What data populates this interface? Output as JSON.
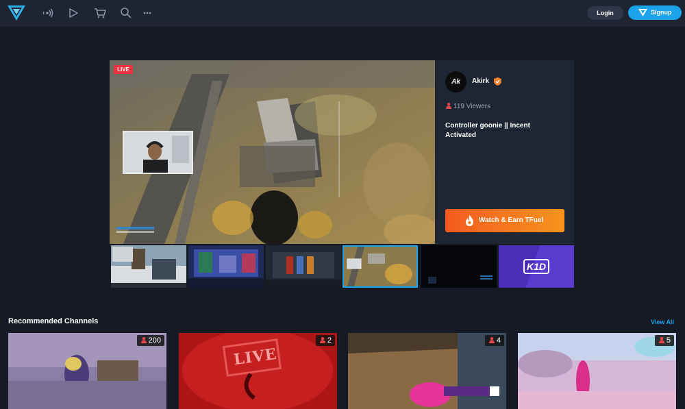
{
  "nav": {
    "login_label": "Login",
    "signup_label": "Signup",
    "icons": [
      "theta-logo-icon",
      "broadcast-icon",
      "play-icon",
      "cart-icon",
      "search-icon",
      "more-icon"
    ]
  },
  "featured": {
    "live_label": "LIVE",
    "channel_name": "Akirk",
    "avatar_initials": "Ak",
    "viewers": "119 Viewers",
    "title": "Controller goonie || Incent Activated",
    "watch_button": "Watch & Earn TFuel"
  },
  "thumbnails": {
    "kid_label": "K1D"
  },
  "recommended": {
    "title": "Recommended Channels",
    "view_all": "View All",
    "channels": [
      {
        "viewers": "200"
      },
      {
        "viewers": "2",
        "live_sign": "LIVE"
      },
      {
        "viewers": "4"
      },
      {
        "viewers": "5"
      }
    ]
  },
  "colors": {
    "background": "#161a24",
    "nav": "#1e2432",
    "accent_blue": "#1ba3ec",
    "live_red": "#e8333d",
    "orange_start": "#f35a1e",
    "orange_end": "#f7941d"
  }
}
